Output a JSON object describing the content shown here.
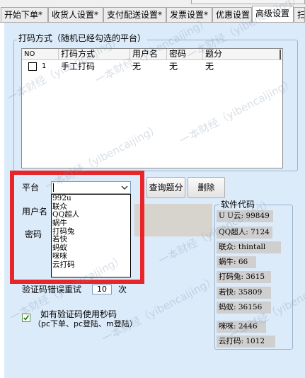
{
  "tabs": [
    {
      "label": "开始下单*",
      "active": false
    },
    {
      "label": "收货人设置*",
      "active": false
    },
    {
      "label": "支付配送设置*",
      "active": false
    },
    {
      "label": "发票设置*",
      "active": false
    },
    {
      "label": "优惠设置",
      "active": false
    },
    {
      "label": "高级设置",
      "active": true
    },
    {
      "label": "扫",
      "active": false
    }
  ],
  "group_title": "打码方式（随机已经勾选的平台）",
  "listview": {
    "columns": [
      "NO",
      "打码方式",
      "用户名",
      "密码",
      "题分"
    ],
    "rows": [
      {
        "no": "1",
        "method": "手工打码",
        "username": "无",
        "password": "无",
        "score": "无",
        "checked": false
      }
    ]
  },
  "platform_label": "平台",
  "platform_dropdown": {
    "value": "",
    "options": [
      "992u",
      "联众",
      "QQ超人",
      "蜗牛",
      "打码兔",
      "若快",
      "蚂蚁",
      "咪咪",
      "云打码"
    ]
  },
  "username_label": "用户名",
  "password_label": "密码",
  "buttons": {
    "query": "查询题分",
    "delete": "删除"
  },
  "software_codes": {
    "title": "软件代码",
    "items": [
      "U U云: 99849",
      "QQ超人: 7124",
      "联众: thintall",
      "蜗牛: 66",
      "打码兔: 3615",
      "若快: 35809",
      "蚂蚁: 36156",
      "咪咪: 2446",
      "云打码: 1012"
    ]
  },
  "retry": {
    "label": "验证码错误重试",
    "value": "10",
    "suffix": "次"
  },
  "seckill_option": {
    "label": "如有验证码使用秒码",
    "sublabel": "（pc下单、pc登陆、m登陆）",
    "checked": true
  },
  "watermark": "一本财经（yibencaijing）",
  "colors": {
    "highlight_frame": "#e8262a",
    "page_background": "#dcebfa"
  }
}
